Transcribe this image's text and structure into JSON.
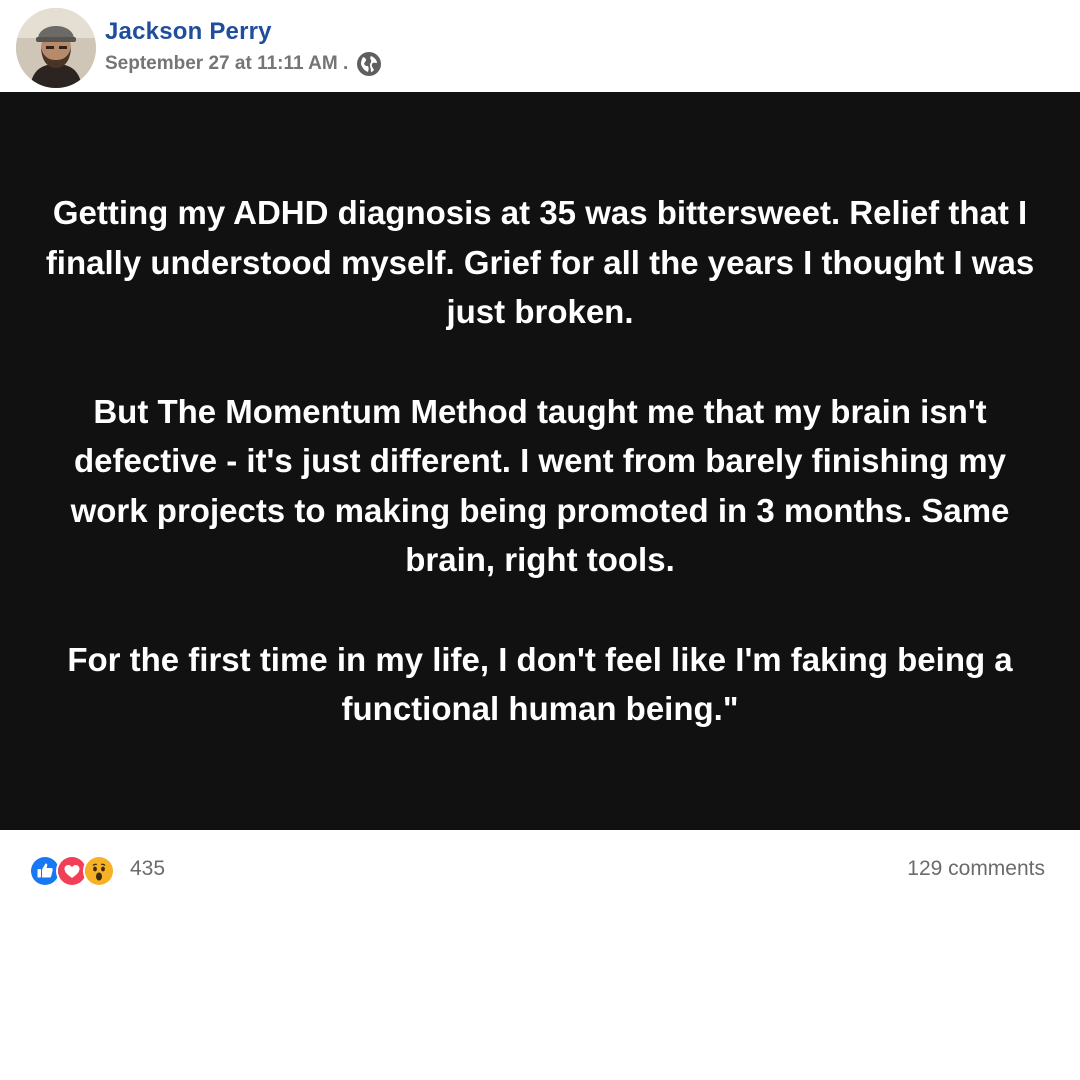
{
  "author": {
    "name": "Jackson Perry",
    "avatar_icon": "profile-photo"
  },
  "post_meta": {
    "timestamp": "September 27 at 11:11 AM .",
    "privacy_icon": "globe-icon"
  },
  "post": {
    "background_color": "#111111",
    "text_color": "#ffffff",
    "paragraphs": [
      "Getting my ADHD diagnosis at 35 was bittersweet. Relief that I finally understood myself. Grief for all the years I thought I was just broken.",
      "But The Momentum Method taught me that my brain isn't defective - it's just different. I went from barely finishing my work projects to making being promoted in 3 months. Same brain, right tools.",
      "For the first time in my life, I don't feel like I'm faking being a functional human being.\""
    ]
  },
  "engagement": {
    "reactions": [
      {
        "icon": "like-icon",
        "color": "#1877f2"
      },
      {
        "icon": "love-icon",
        "color": "#f33e58"
      },
      {
        "icon": "wow-icon",
        "color": "#f7b125"
      }
    ],
    "reaction_count": "435",
    "comments_label": "129 comments"
  }
}
